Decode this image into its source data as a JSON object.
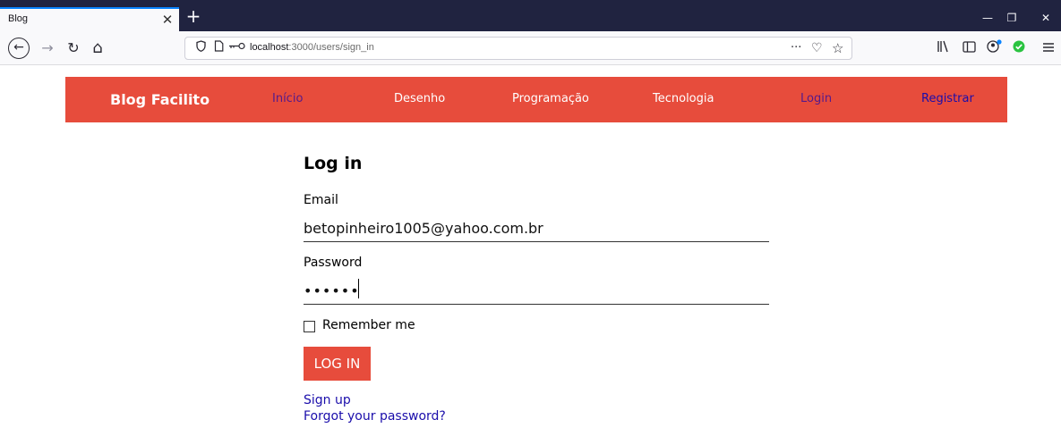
{
  "browser": {
    "tab_title": "Blog",
    "tab_close": "✕",
    "new_tab": "+",
    "window_controls": [
      "—",
      "❐",
      "✕"
    ],
    "nav": {
      "back": "←",
      "forward": "→",
      "reload": "↻",
      "home": "⌂"
    },
    "url": {
      "host": "localhost",
      "path": ":3000/users/sign_in"
    },
    "url_actions": [
      "···",
      "♡",
      "☆"
    ],
    "toolbar_icons": [
      "library-icon",
      "sidebar-icon",
      "account-icon",
      "extension-check-icon",
      "menu-icon"
    ]
  },
  "header": {
    "brand": "Blog Facilito",
    "menu": [
      {
        "label": "Início",
        "state": "visited"
      },
      {
        "label": "Desenho",
        "state": "normal"
      },
      {
        "label": "Programação",
        "state": "normal"
      },
      {
        "label": "Tecnologia",
        "state": "normal"
      },
      {
        "label": "Login",
        "state": "visited"
      },
      {
        "label": "Registrar",
        "state": "link"
      }
    ],
    "colors": {
      "accent": "#e74c3c",
      "visited": "#551a8b",
      "link": "#1a0dab"
    }
  },
  "form": {
    "title": "Log in",
    "email_label": "Email",
    "email_value": "betopinheiro1005@yahoo.com.br",
    "password_label": "Password",
    "password_value": "••••••",
    "remember_label": "Remember me",
    "remember_checked": false,
    "submit_label": "LOG IN",
    "links": [
      "Sign up",
      "Forgot your password?"
    ]
  }
}
